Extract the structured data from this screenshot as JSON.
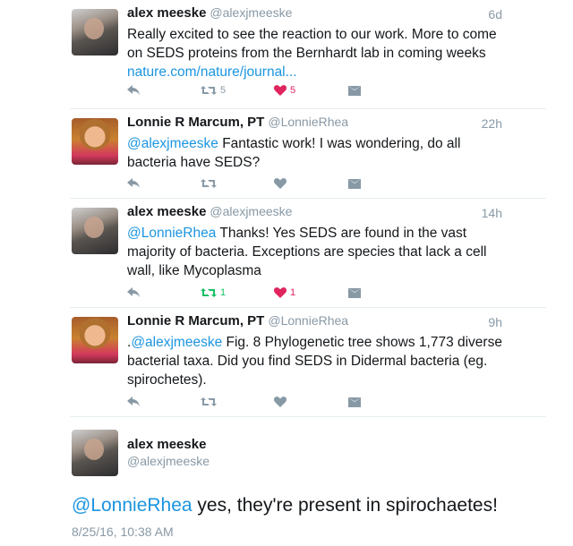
{
  "tweets": [
    {
      "name": "alex meeske",
      "handle": "@alexjmeeske",
      "time": "6d",
      "avatar": "alex-avatar",
      "mention": "",
      "text": "Really excited to see the reaction to our work. More to come on SEDS proteins from the Bernhardt lab in coming weeks ",
      "link": "nature.com/nature/journal...",
      "retweets": "5",
      "likes": "5",
      "liked": true,
      "retweeted": false
    },
    {
      "name": "Lonnie R Marcum, PT",
      "handle": "@LonnieRhea",
      "time": "22h",
      "avatar": "lonnie-avatar",
      "mention": "@alexjmeeske",
      "text": " Fantastic work! I was wondering, do all bacteria have SEDS?",
      "link": "",
      "retweets": "",
      "likes": "",
      "liked": false,
      "retweeted": false
    },
    {
      "name": "alex meeske",
      "handle": "@alexjmeeske",
      "time": "14h",
      "avatar": "alex-avatar",
      "mention": "@LonnieRhea",
      "text": " Thanks! Yes SEDS are found in the vast majority of bacteria. Exceptions are species that lack a cell wall, like Mycoplasma",
      "link": "",
      "retweets": "1",
      "likes": "1",
      "liked": true,
      "retweeted": true
    },
    {
      "name": "Lonnie R Marcum, PT",
      "handle": "@LonnieRhea",
      "time": "9h",
      "avatar": "lonnie-avatar",
      "prefix": ".",
      "mention": "@alexjmeeske",
      "text": " Fig. 8 Phylogenetic tree shows 1,773 diverse bacterial taxa. Did you find SEDS in Didermal bacteria (eg. spirochetes).",
      "link": "",
      "retweets": "",
      "likes": "",
      "liked": false,
      "retweeted": false
    }
  ],
  "focus": {
    "name": "alex meeske",
    "handle": "@alexjmeeske",
    "mention": "@LonnieRhea",
    "text": " yes, they're present in spirochaetes!",
    "date": "8/25/16, 10:38 AM"
  },
  "colors": {
    "link": "#1b95e0",
    "like_active": "#e0245e",
    "retweet_active": "#17bf63",
    "muted": "#8899a6"
  }
}
